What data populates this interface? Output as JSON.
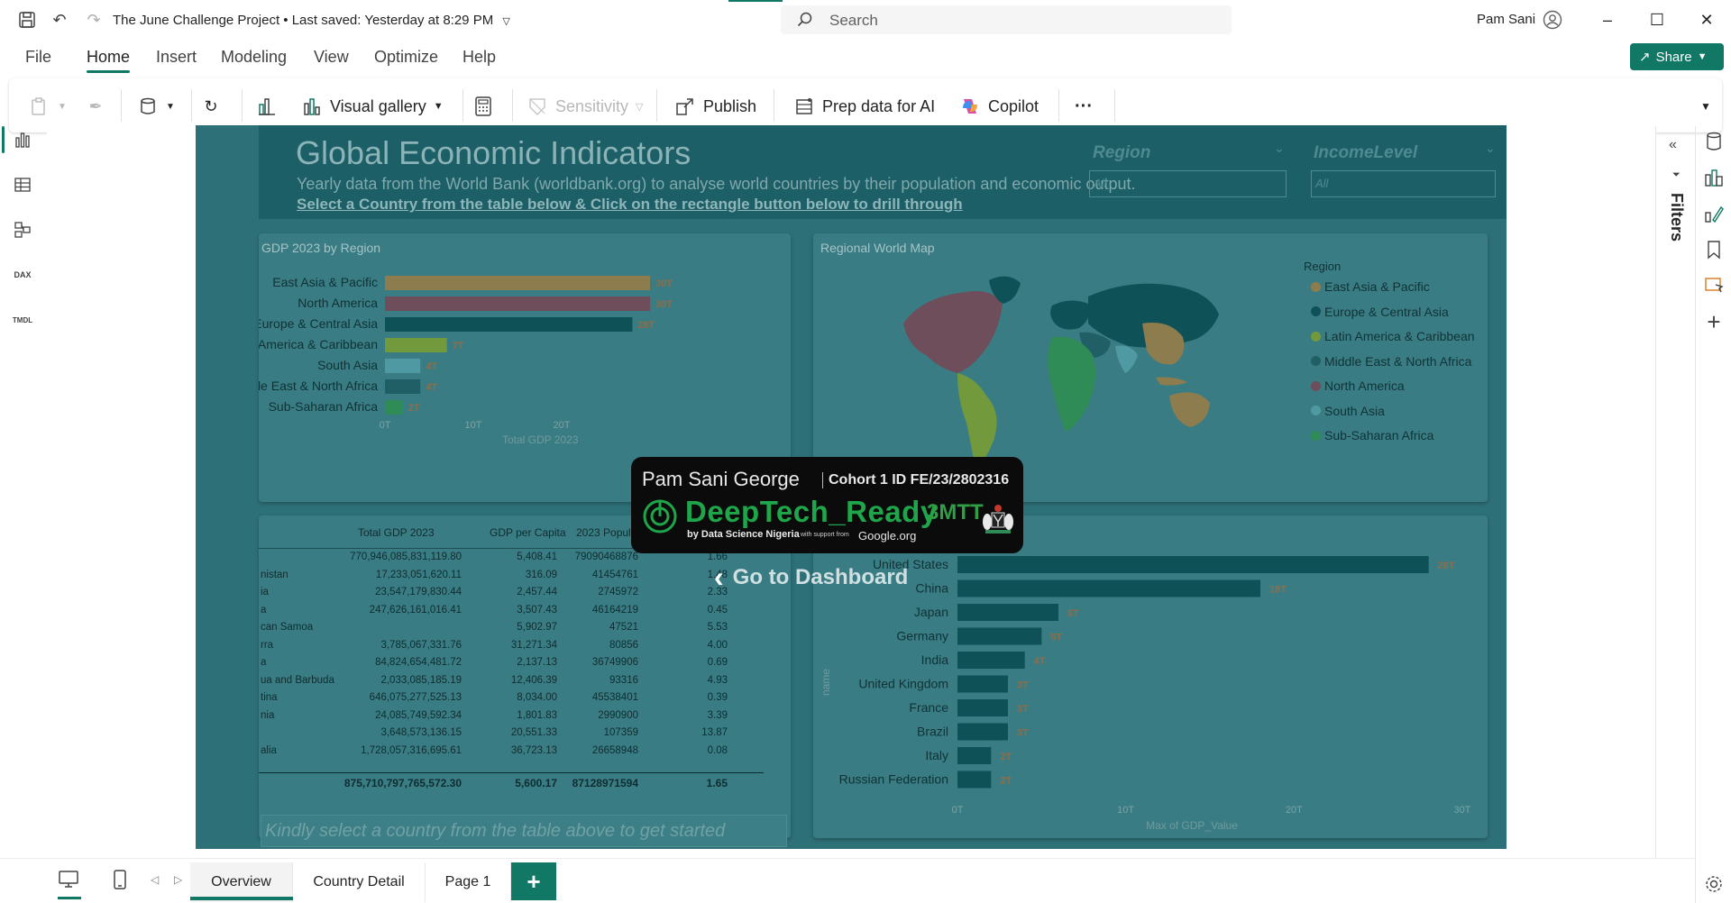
{
  "titlebar": {
    "doc_title": "The June Challenge Project",
    "saved_status": "Last saved: Yesterday at 8:29 PM",
    "search_placeholder": "Search",
    "user_name": "Pam Sani"
  },
  "menu": {
    "items": [
      "File",
      "Home",
      "Insert",
      "Modeling",
      "View",
      "Optimize",
      "Help"
    ],
    "active": "Home",
    "share_label": "Share"
  },
  "ribbon": {
    "visual_gallery": "Visual gallery",
    "sensitivity": "Sensitivity",
    "publish": "Publish",
    "prep_data": "Prep data for AI",
    "copilot": "Copilot",
    "more": "···"
  },
  "leftnav": {
    "items": [
      "report-view-icon",
      "table-view-icon",
      "model-view-icon",
      "dax-query-icon",
      "tmdl-view-icon"
    ],
    "dax": "DAX",
    "tmdl": "TMDL"
  },
  "report": {
    "title": "Global Economic Indicators",
    "subtitle": "Yearly data from the World Bank (worldbank.org) to analyse world countries by their population and economic output.",
    "instruction": "Select a Country from the table below & Click on the rectangle button below to drill through",
    "slicers": [
      {
        "label": "Region",
        "value": "All"
      },
      {
        "label": "IncomeLevel",
        "value": "All"
      }
    ],
    "region_panel_title": "GDP 2023 by Region",
    "map_panel_title": "Regional World Map",
    "map_legend_title": "Region",
    "goto_label": "Go to Dashboard",
    "bottom_prompt": "Kindly select a country from the table above to get started"
  },
  "colors": {
    "accent": "#117865",
    "east_asia_pacific": "#8d7d4e",
    "north_america": "#6e4e5a",
    "europe_central_asia": "#0e5157",
    "latin_america_caribbean": "#729a3c",
    "south_asia": "#4f9aa2",
    "middle_east_north_africa": "#205f66",
    "sub_saharan_africa": "#2f8c57"
  },
  "chart_data": [
    {
      "type": "bar",
      "orientation": "horizontal",
      "title": "GDP 2023 by Region",
      "categories": [
        "East Asia & Pacific",
        "North America",
        "Europe & Central Asia",
        "Latin America & Caribbean",
        "South Asia",
        "Middle East & North Africa",
        "Sub-Saharan Africa"
      ],
      "values": [
        30,
        30,
        28,
        7,
        4,
        4,
        2
      ],
      "data_labels": [
        "30T",
        "30T",
        "28T",
        "7T",
        "4T",
        "4T",
        "2T"
      ],
      "xlabel": "Total GDP 2023",
      "x_ticks": [
        "0T",
        "10T",
        "20T"
      ],
      "xlim": [
        0,
        30
      ]
    },
    {
      "type": "bar",
      "orientation": "horizontal",
      "categories": [
        "United States",
        "China",
        "Japan",
        "Germany",
        "India",
        "United Kingdom",
        "France",
        "Brazil",
        "Italy",
        "Russian Federation"
      ],
      "values": [
        28,
        18,
        6,
        5,
        4,
        3,
        3,
        3,
        2,
        2
      ],
      "data_labels": [
        "28T",
        "18T",
        "6T",
        "5T",
        "4T",
        "3T",
        "3T",
        "3T",
        "2T",
        "2T"
      ],
      "xlabel": "Max of GDP_Value",
      "ylabel": "name",
      "x_ticks": [
        "0T",
        "10T",
        "20T",
        "30T"
      ],
      "xlim": [
        0,
        30
      ]
    }
  ],
  "table": {
    "headers": [
      "Total GDP 2023",
      "GDP per Capita",
      "2023 Popul"
    ],
    "rows": [
      [
        "",
        "770,946,085,831,119.80",
        "5,408.41",
        "79090468876",
        "1.66"
      ],
      [
        "nistan",
        "17,233,051,620.11",
        "316.09",
        "41454761",
        "1.48"
      ],
      [
        "ia",
        "23,547,179,830.44",
        "2,457.44",
        "2745972",
        "2.33"
      ],
      [
        "a",
        "247,626,161,016.41",
        "3,507.43",
        "46164219",
        "0.45"
      ],
      [
        "can Samoa",
        "",
        "5,902.97",
        "47521",
        "5.53"
      ],
      [
        "rra",
        "3,785,067,331.76",
        "31,271.34",
        "80856",
        "4.00"
      ],
      [
        "a",
        "84,824,654,481.72",
        "2,137.13",
        "36749906",
        "0.69"
      ],
      [
        "ua and Barbuda",
        "2,033,085,185.19",
        "12,406.39",
        "93316",
        "4.93"
      ],
      [
        "tina",
        "646,075,277,525.13",
        "8,034.00",
        "45538401",
        "0.39"
      ],
      [
        "nia",
        "24,085,749,592.34",
        "1,801.83",
        "2990900",
        "3.39"
      ],
      [
        "",
        "3,648,573,136.15",
        "20,551.33",
        "107359",
        "13.87"
      ],
      [
        "alia",
        "1,728,057,316,695.61",
        "36,723.13",
        "26658948",
        "0.08"
      ]
    ],
    "totals": [
      "875,710,797,765,572.30",
      "5,600.17",
      "87128971594",
      "1.65"
    ]
  },
  "badge": {
    "name": "Pam Sani George",
    "cohort": "Cohort 1 ID FE/23/2802316",
    "program": "DeepTech_Ready",
    "by": "by Data Science Nigeria",
    "support": "with support from",
    "google": "Google.org",
    "mtt": "3MTT"
  },
  "filters": {
    "label": "Filters"
  },
  "pages": {
    "tabs": [
      "Overview",
      "Country Detail",
      "Page 1"
    ],
    "active": "Overview",
    "add": "+"
  }
}
